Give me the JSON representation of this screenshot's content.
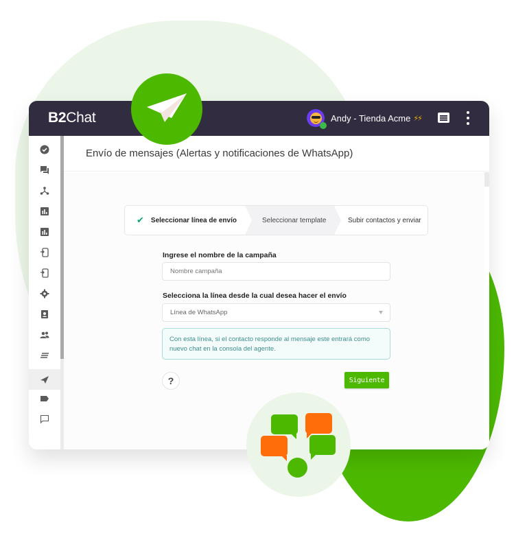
{
  "app": {
    "logo": {
      "prefix": "B2",
      "suffix": "Chat"
    },
    "user": {
      "name": "Andy - Tienda Acme",
      "badge": "⚡⚡",
      "status": "online"
    },
    "topbar_icons": [
      "chat-icon",
      "more-vert-icon"
    ]
  },
  "sidebar": {
    "items": [
      {
        "icon": "check-circle-icon",
        "active": false
      },
      {
        "icon": "forum-icon",
        "active": false
      },
      {
        "icon": "hub-icon",
        "active": false
      },
      {
        "icon": "bar-chart-icon",
        "active": false
      },
      {
        "icon": "bar-chart-icon",
        "active": false
      },
      {
        "icon": "integration-icon",
        "active": false
      },
      {
        "icon": "integration-icon",
        "active": false
      },
      {
        "icon": "settings-icon",
        "active": false
      },
      {
        "icon": "contact-card-icon",
        "active": false
      },
      {
        "icon": "group-icon",
        "active": false
      },
      {
        "icon": "lines-icon",
        "active": false
      },
      {
        "icon": "send-icon",
        "active": true
      },
      {
        "icon": "tag-icon",
        "active": false
      },
      {
        "icon": "chat-bubble-outline-icon",
        "active": false
      }
    ]
  },
  "page": {
    "title": "Envío de mensajes (Alertas y notificaciones de WhatsApp)"
  },
  "stepper": {
    "steps": [
      {
        "label": "Seleccionar línea de envío",
        "status": "completed"
      },
      {
        "label": "Seleccionar template",
        "status": "current"
      },
      {
        "label": "Subir contactos y enviar",
        "status": "pending"
      }
    ]
  },
  "form": {
    "campaign_label": "Ingrese el nombre de la campaña",
    "campaign_value": "",
    "campaign_placeholder": "Nombre campaña",
    "line_label": "Selecciona la línea desde la cual desea hacer el envío",
    "line_selected": "Línea de WhatsApp",
    "info_text": "Con esta línea, si el contacto responde al mensaje este entrará como nuevo chat en la consola del agente.",
    "help_label": "?",
    "next_label": "Siguiente"
  },
  "colors": {
    "brand_green": "#4cb900",
    "brand_orange": "#ff6d0a",
    "topbar": "#312c40",
    "info_border": "#a8dcd9",
    "info_text": "#3d8f8c",
    "step_check": "#0aa86b"
  }
}
